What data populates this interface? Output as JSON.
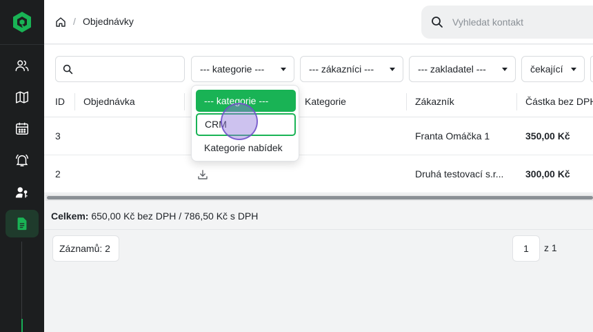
{
  "header": {
    "breadcrumb_title": "Objednávky",
    "breadcrumb_separator": "/",
    "search_placeholder": "Vyhledat kontakt"
  },
  "sidebar": {
    "items": [
      {
        "icon": "users-icon",
        "active": false
      },
      {
        "icon": "map-icon",
        "active": false
      },
      {
        "icon": "calendar-icon",
        "active": false
      },
      {
        "icon": "bell-icon",
        "active": false
      },
      {
        "icon": "user-key-icon",
        "active": false
      },
      {
        "icon": "document-icon",
        "active": true
      }
    ]
  },
  "filters": {
    "search_value": "",
    "category": "--- kategorie ---",
    "customers": "--- zákazníci ---",
    "founder": "--- zakladatel ---",
    "status": "čekající"
  },
  "table": {
    "columns": [
      "ID",
      "Objednávka",
      "Kategorie",
      "Zákazník",
      "Částka bez DPH"
    ],
    "rows": [
      {
        "id": "3",
        "order": "",
        "category": "",
        "customer": "Franta Omáčka 1",
        "amount": "350,00 Kč",
        "download": false
      },
      {
        "id": "2",
        "order": "",
        "category": "",
        "customer": "Druhá testovací s.r...",
        "amount": "300,00 Kč",
        "download": true
      }
    ]
  },
  "summary": {
    "label": "Celkem:",
    "text": "650,00 Kč bez DPH / 786,50 Kč s DPH"
  },
  "pagination": {
    "records": "Záznamů: 2",
    "page": "1",
    "of": "z 1"
  },
  "category_dropdown": {
    "options": [
      "--- kategorie ---",
      "CRM",
      "Kategorie nabídek"
    ],
    "selected_index": 0,
    "focused_index": 1
  },
  "colors": {
    "accent": "#19b355",
    "sidebar_bg": "#1c1e1f"
  }
}
